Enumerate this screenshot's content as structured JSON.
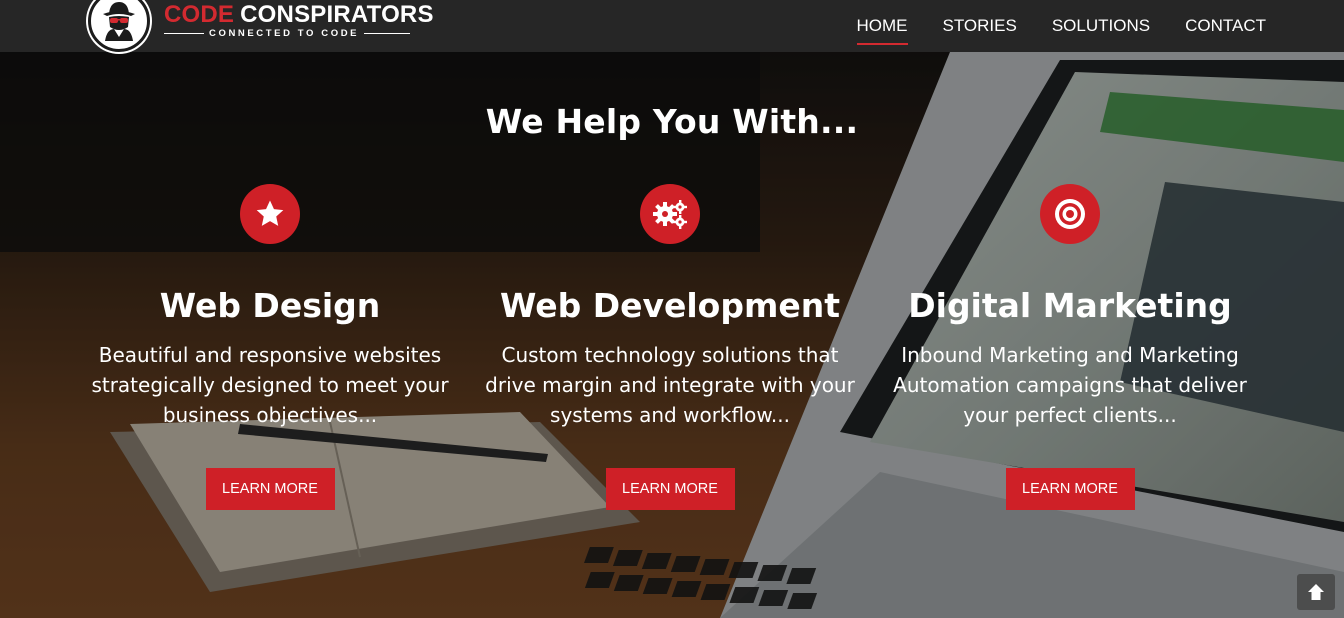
{
  "brand": {
    "word1": "CODE",
    "word2": "CONSPIRATORS",
    "tagline": "CONNECTED TO CODE",
    "accent": "#d32a30",
    "icon": "spy-logo-icon"
  },
  "nav": {
    "items": [
      {
        "label": "HOME",
        "active": true
      },
      {
        "label": "STORIES",
        "active": false
      },
      {
        "label": "SOLUTIONS",
        "active": false
      },
      {
        "label": "CONTACT",
        "active": false
      }
    ]
  },
  "hero": {
    "title": "We Help You With...",
    "services": [
      {
        "icon": "star-icon",
        "title": "Web Design",
        "description": "Beautiful and responsive websites strategically designed to meet your business objectives...",
        "button": "LEARN MORE"
      },
      {
        "icon": "gears-icon",
        "title": "Web Development",
        "description": "Custom technology solutions that drive margin and integrate with your systems and workflow...",
        "button": "LEARN MORE"
      },
      {
        "icon": "target-icon",
        "title": "Digital Marketing",
        "description": "Inbound Marketing and Marketing Automation campaigns that deliver your perfect clients...",
        "button": "LEARN MORE"
      }
    ]
  },
  "back_to_top": {
    "icon": "arrow-up-icon"
  },
  "colors": {
    "header_bg": "#262626",
    "button_red": "#cf2027"
  }
}
